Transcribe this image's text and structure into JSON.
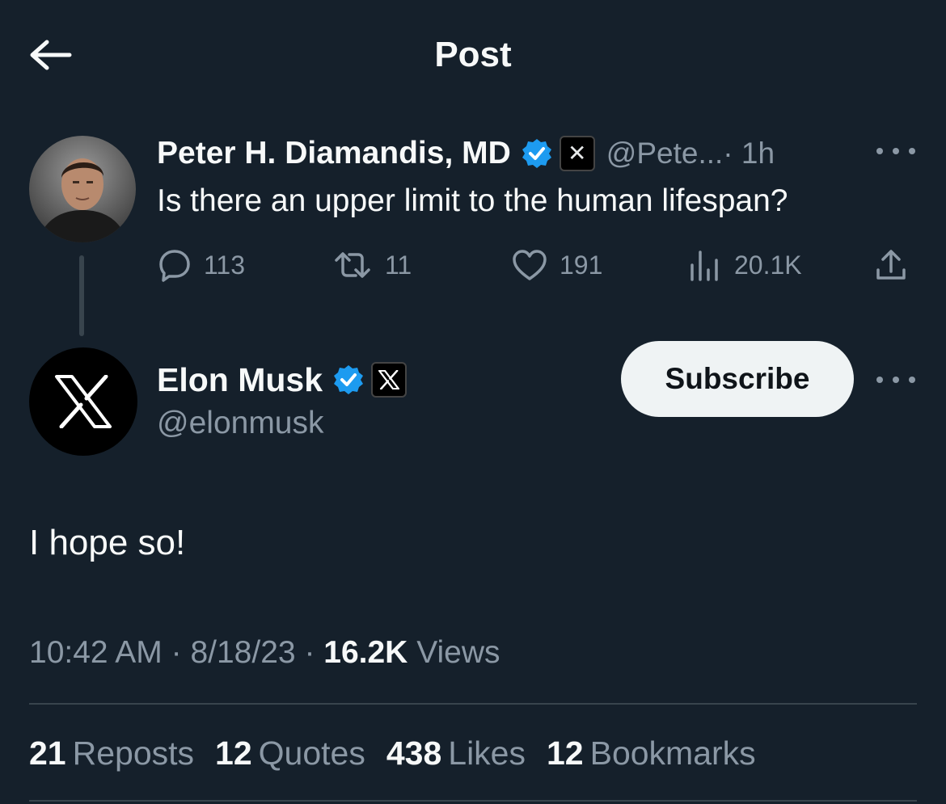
{
  "header": {
    "title": "Post"
  },
  "parent": {
    "name": "Peter H. Diamandis, MD",
    "handle": "@Pete...",
    "time": "· 1h",
    "text": "Is there an upper limit to the human lifespan?",
    "actions": {
      "replies": "113",
      "reposts": "11",
      "likes": "191",
      "views": "20.1K"
    }
  },
  "main": {
    "name": "Elon Musk",
    "handle": "@elonmusk",
    "subscribe_label": "Subscribe",
    "text": "I hope so!",
    "time": "10:42 AM",
    "date": "8/18/23",
    "views_count": "16.2K",
    "views_label": "Views",
    "stats": [
      {
        "count": "21",
        "label": "Reposts"
      },
      {
        "count": "12",
        "label": "Quotes"
      },
      {
        "count": "438",
        "label": "Likes"
      },
      {
        "count": "12",
        "label": "Bookmarks"
      }
    ]
  },
  "colors": {
    "background": "#15202b",
    "verified": "#1d9bf0",
    "secondary_text": "#8b98a5"
  }
}
